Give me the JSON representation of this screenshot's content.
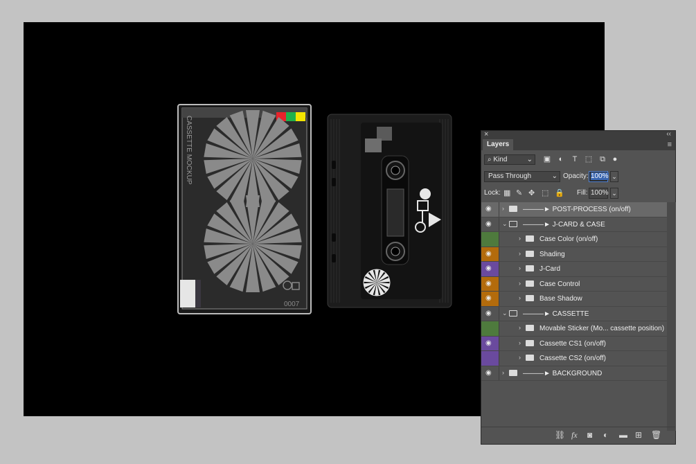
{
  "artwork": {
    "jcard_spine_text": "CASSETTE MOCKUP",
    "jcard_code": "0007",
    "colors": {
      "red": "#e8232b",
      "green": "#1fb14b",
      "yellow": "#f4e500",
      "canvas": "#000000",
      "background": "#c3c3c3"
    }
  },
  "layers_panel": {
    "tab_label": "Layers",
    "close_icon": "×",
    "collapse_icon": "‹‹",
    "menu_icon": "≡",
    "kind_label": "Kind",
    "blend_mode": "Pass Through",
    "opacity_label": "Opacity:",
    "opacity_value": "100%",
    "lock_label": "Lock:",
    "fill_label": "Fill:",
    "fill_value": "100%",
    "layers": [
      {
        "name": "———► POST-PROCESS (on/off)",
        "visible": true,
        "tag_color": "",
        "indent": 0,
        "expanded": false,
        "selected": true
      },
      {
        "name": "———► J-CARD & CASE",
        "visible": true,
        "tag_color": "",
        "indent": 0,
        "expanded": true,
        "selected": false
      },
      {
        "name": "Case Color (on/off)",
        "visible": false,
        "tag_color": "#4e7a3d",
        "indent": 1,
        "expanded": false,
        "selected": false
      },
      {
        "name": "Shading",
        "visible": true,
        "tag_color": "#b36b0c",
        "indent": 1,
        "expanded": false,
        "selected": false
      },
      {
        "name": "J-Card",
        "visible": true,
        "tag_color": "#6a4a9e",
        "indent": 1,
        "expanded": false,
        "selected": false
      },
      {
        "name": "Case Control",
        "visible": true,
        "tag_color": "#b36b0c",
        "indent": 1,
        "expanded": false,
        "selected": false
      },
      {
        "name": "Base Shadow",
        "visible": true,
        "tag_color": "#b36b0c",
        "indent": 1,
        "expanded": false,
        "selected": false
      },
      {
        "name": "———► CASSETTE",
        "visible": true,
        "tag_color": "",
        "indent": 0,
        "expanded": true,
        "selected": false
      },
      {
        "name": "Movable Sticker (Mo... cassette position)",
        "visible": false,
        "tag_color": "#4e7a3d",
        "indent": 1,
        "expanded": false,
        "selected": false
      },
      {
        "name": "Cassette CS1 (on/off)",
        "visible": true,
        "tag_color": "#6a4a9e",
        "indent": 1,
        "expanded": false,
        "selected": false
      },
      {
        "name": "Cassette CS2 (on/off)",
        "visible": false,
        "tag_color": "#6a4a9e",
        "indent": 1,
        "expanded": false,
        "selected": false
      },
      {
        "name": "———► BACKGROUND",
        "visible": true,
        "tag_color": "",
        "indent": 0,
        "expanded": false,
        "selected": false
      }
    ],
    "footer_icons": [
      "link-icon",
      "fx-icon",
      "mask-icon",
      "adjustment-icon",
      "new-group-icon",
      "new-layer-icon",
      "trash-icon"
    ]
  }
}
